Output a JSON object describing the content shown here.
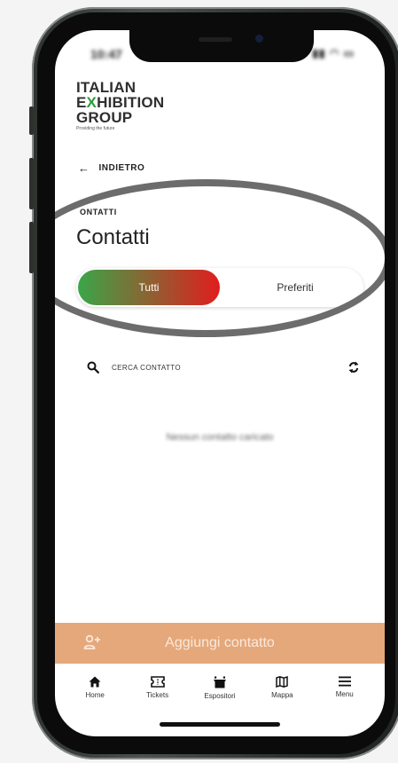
{
  "status_bar": {
    "time": "10:47",
    "icons": "▮▮ ◠ ▭"
  },
  "logo": {
    "line1": "ITALIAN",
    "line2_a": "E",
    "line2_x": "X",
    "line2_b": "HIBITION",
    "line3": "GROUP",
    "tagline": "Providing the future"
  },
  "nav": {
    "back_label": "INDIETRO"
  },
  "section": {
    "label": "ONTATTI",
    "title": "Contatti"
  },
  "toggle": {
    "active_label": "Tutti",
    "inactive_label": "Preferiti"
  },
  "search": {
    "label": "CERCA CONTATTO"
  },
  "empty_state": "Nessun contatto caricato",
  "add_contact": {
    "label": "Aggiungi contatto"
  },
  "tabs": [
    {
      "label": "Home",
      "icon": "home-icon"
    },
    {
      "label": "Tickets",
      "icon": "ticket-icon"
    },
    {
      "label": "Espositori",
      "icon": "exhibitor-icon"
    },
    {
      "label": "Mappa",
      "icon": "map-icon"
    },
    {
      "label": "Menu",
      "icon": "menu-icon"
    }
  ],
  "colors": {
    "accent_green": "#3aa648",
    "accent_red": "#e11d1d",
    "add_bar": "#e5a87a"
  }
}
